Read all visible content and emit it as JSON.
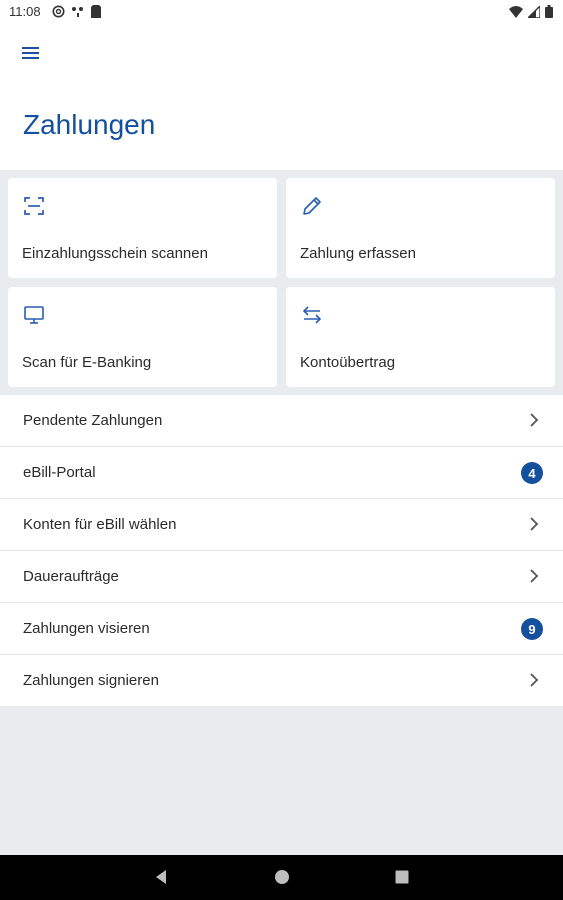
{
  "status_bar": {
    "time": "11:08",
    "icons": [
      "at-icon",
      "network-icon",
      "sim-icon",
      "wifi-icon",
      "signal-icon",
      "battery-icon"
    ]
  },
  "header": {
    "title": "Zahlungen",
    "menu_icon": "hamburger-menu-icon"
  },
  "tiles": [
    {
      "label": "Einzahlungsschein scannen",
      "icon": "scan-icon"
    },
    {
      "label": "Zahlung erfassen",
      "icon": "pencil-icon"
    },
    {
      "label": "Scan für E-Banking",
      "icon": "monitor-icon"
    },
    {
      "label": "Kontoübertrag",
      "icon": "transfer-arrows-icon"
    }
  ],
  "list": [
    {
      "label": "Pendente Zahlungen",
      "badge": null
    },
    {
      "label": "eBill-Portal",
      "badge": "4"
    },
    {
      "label": "Konten für eBill wählen",
      "badge": null
    },
    {
      "label": "Daueraufträge",
      "badge": null
    },
    {
      "label": "Zahlungen visieren",
      "badge": "9"
    },
    {
      "label": "Zahlungen signieren",
      "badge": null
    }
  ],
  "nav_bar": {
    "buttons": [
      "back-icon",
      "home-icon",
      "recents-icon"
    ]
  },
  "colors": {
    "accent": "#1550a0",
    "badge": "#15509e",
    "background": "#e9ecee"
  }
}
